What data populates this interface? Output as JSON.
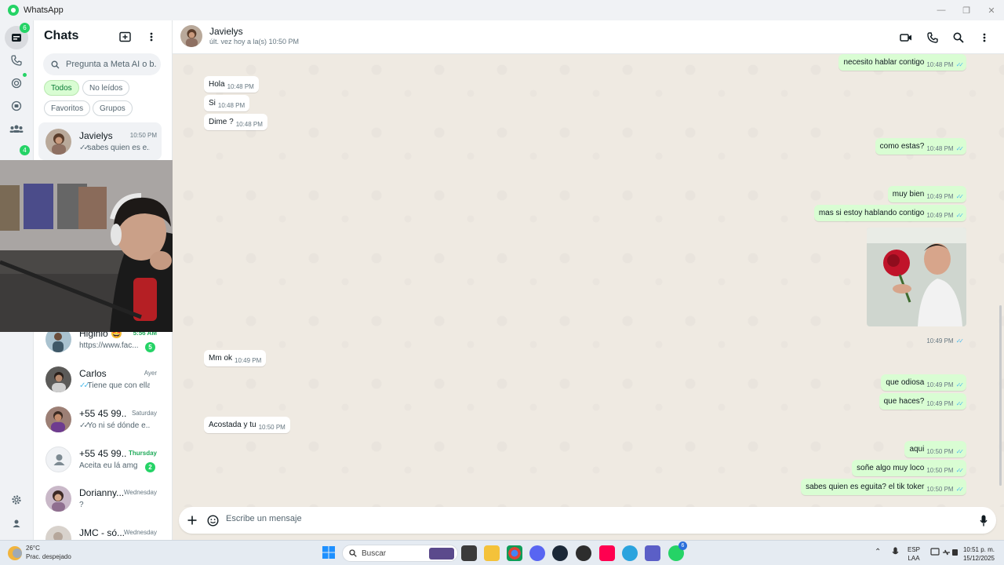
{
  "window": {
    "title": "WhatsApp"
  },
  "rail": {
    "chats_badge": "6",
    "channels_badge": "4"
  },
  "panel": {
    "title": "Chats",
    "search_placeholder": "Pregunta a Meta AI o b...",
    "filters": [
      "Todos",
      "No leídos",
      "Favoritos",
      "Grupos"
    ],
    "chats": [
      {
        "name": "Javielys",
        "time": "10:50 PM",
        "preview": "sabes quien es e...",
        "ticks": true,
        "badge": ""
      },
      {
        "name": "Higinio 🤩",
        "time": "5:56 AM",
        "preview": "https://www.fac...",
        "ticks": false,
        "badge": "5"
      },
      {
        "name": "Carlos",
        "time": "Ayer",
        "preview": "Tiene que con ella",
        "ticks": true,
        "badge": ""
      },
      {
        "name": "+55 45 99...",
        "time": "Saturday",
        "preview": "Yo ni sé dónde e...",
        "ticks": true,
        "badge": ""
      },
      {
        "name": "+55 45 99...",
        "time": "Thursday",
        "preview": "Aceita eu lá amg",
        "ticks": false,
        "badge": "2"
      },
      {
        "name": "Dorianny...",
        "time": "Wednesday",
        "preview": "?",
        "ticks": false,
        "badge": ""
      },
      {
        "name": "JMC - só...",
        "time": "Wednesday",
        "preview": "",
        "ticks": false,
        "badge": ""
      }
    ]
  },
  "conversation": {
    "name": "Javielys",
    "status": "últ. vez hoy a la(s) 10:50 PM",
    "messages": [
      {
        "dir": "out",
        "text": "necesito hablar contigo",
        "time": "10:48 PM"
      },
      {
        "dir": "in",
        "text": "Hola",
        "time": "10:48 PM"
      },
      {
        "dir": "in",
        "text": "Si",
        "time": "10:48 PM"
      },
      {
        "dir": "in",
        "text": "Dime ?",
        "time": "10:48 PM"
      },
      {
        "dir": "out",
        "text": "como estas?",
        "time": "10:48 PM"
      },
      {
        "dir": "out",
        "text": "muy bien",
        "time": "10:49 PM"
      },
      {
        "dir": "out",
        "text": "mas si estoy hablando contigo",
        "time": "10:49 PM"
      },
      {
        "dir": "out",
        "text": "",
        "time": "10:49 PM"
      },
      {
        "dir": "in",
        "text": "Mm ok",
        "time": "10:49 PM"
      },
      {
        "dir": "out",
        "text": "que odiosa",
        "time": "10:49 PM"
      },
      {
        "dir": "out",
        "text": "que haces?",
        "time": "10:49 PM"
      },
      {
        "dir": "in",
        "text": "Acostada y tu",
        "time": "10:50 PM"
      },
      {
        "dir": "out",
        "text": "aqui",
        "time": "10:50 PM"
      },
      {
        "dir": "out",
        "text": "soñe algo muy loco",
        "time": "10:50 PM"
      },
      {
        "dir": "out",
        "text": "sabes quien es eguita? el tik toker",
        "time": "10:50 PM"
      }
    ],
    "composer_placeholder": "Escribe un mensaje"
  },
  "taskbar": {
    "temperature": "26°C",
    "weather": "Prac. despejado",
    "search_label": "Buscar",
    "language": "ESP",
    "language_sub": "LAA",
    "time": "10:51 p. m.",
    "date": "15/12/2025",
    "whatsapp_badge": "6"
  }
}
